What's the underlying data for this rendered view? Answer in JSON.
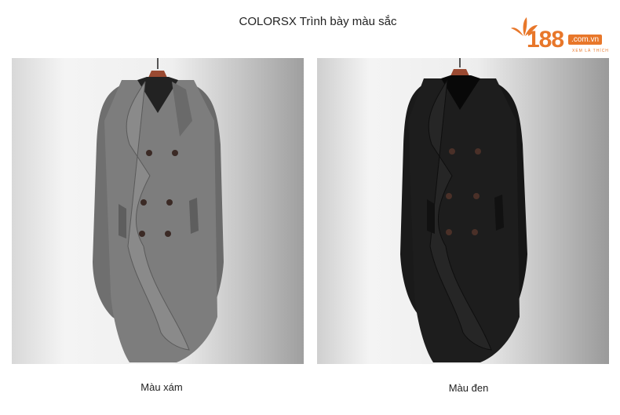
{
  "header": {
    "title": "COLORSX Trình bày màu sắc"
  },
  "logo": {
    "number": "188",
    "domain": ".com.vn",
    "tagline": "XEM LÀ THÍCH"
  },
  "products": [
    {
      "caption": "Màu xám",
      "color": "#7d7d7d"
    },
    {
      "caption": "Màu đen",
      "color": "#1b1b1b"
    }
  ]
}
